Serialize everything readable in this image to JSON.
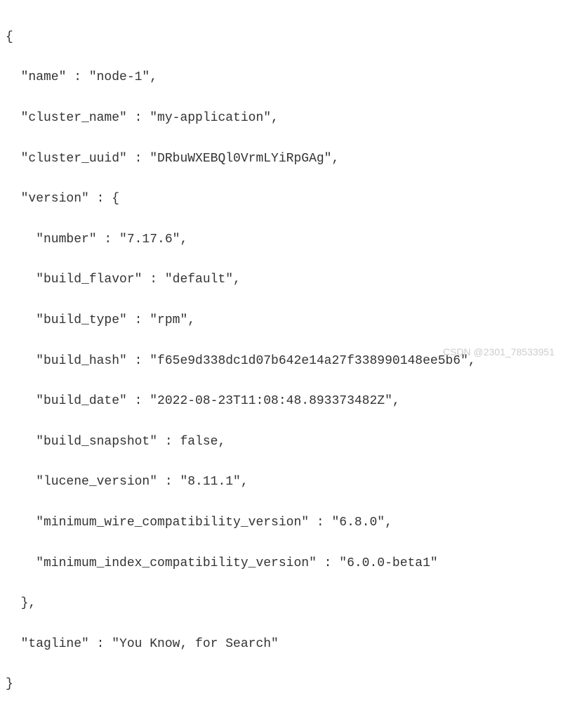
{
  "lines": {
    "open": "{",
    "l1": "  \"name\" : \"node-1\",",
    "l2": "  \"cluster_name\" : \"my-application\",",
    "l3": "  \"cluster_uuid\" : \"DRbuWXEBQl0VrmLYiRpGAg\",",
    "l4": "  \"version\" : {",
    "l5": "    \"number\" : \"7.17.6\",",
    "l6": "    \"build_flavor\" : \"default\",",
    "l7": "    \"build_type\" : \"rpm\",",
    "l8": "    \"build_hash\" : \"f65e9d338dc1d07b642e14a27f338990148ee5b6\",",
    "l9": "    \"build_date\" : \"2022-08-23T11:08:48.893373482Z\",",
    "l10": "    \"build_snapshot\" : false,",
    "l11": "    \"lucene_version\" : \"8.11.1\",",
    "l12": "    \"minimum_wire_compatibility_version\" : \"6.8.0\",",
    "l13": "    \"minimum_index_compatibility_version\" : \"6.0.0-beta1\"",
    "l14": "  },",
    "l15": "  \"tagline\" : \"You Know, for Search\"",
    "close": "}"
  },
  "watermark": "CSDN @2301_78533951"
}
